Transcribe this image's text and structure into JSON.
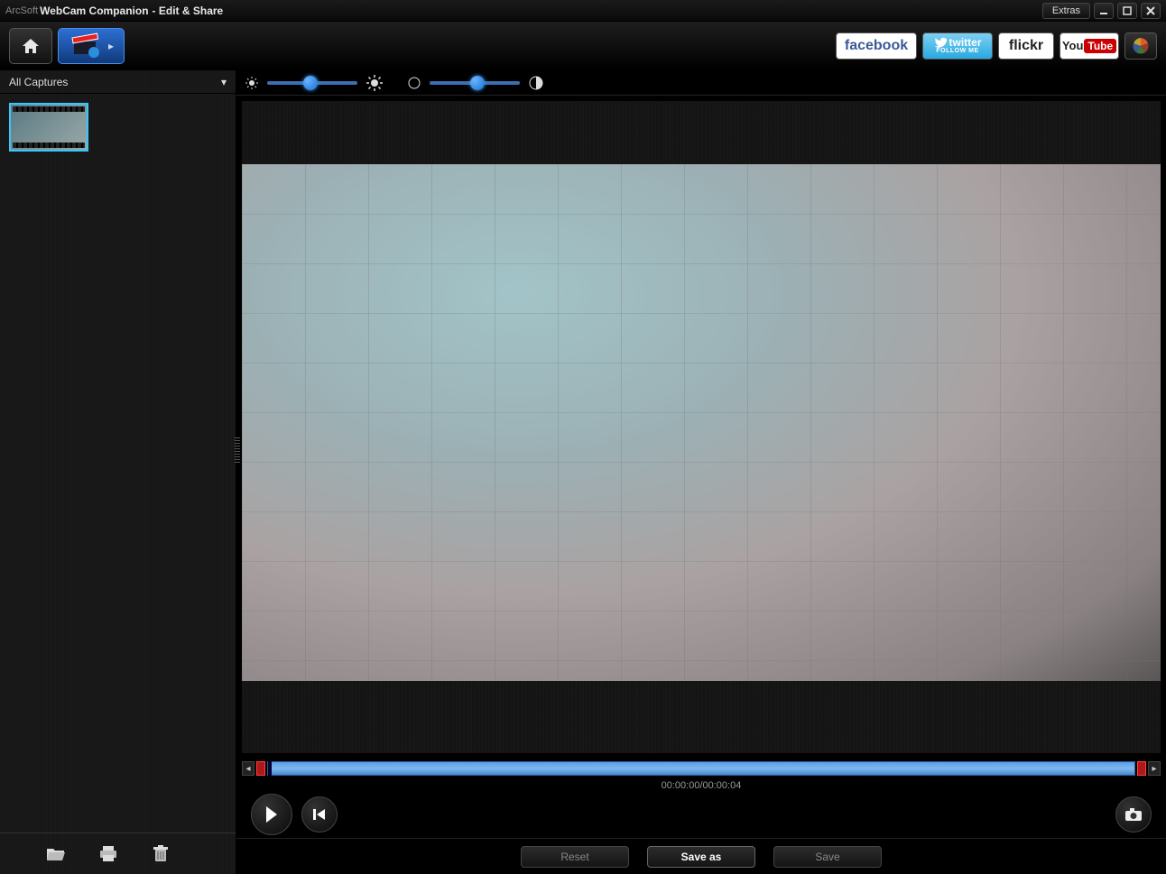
{
  "titlebar": {
    "brand": "ArcSoft",
    "app": "WebCam Companion",
    "subtitle": " - Edit & Share",
    "extras": "Extras"
  },
  "share": {
    "facebook": "facebook",
    "twitter_top": "twitter",
    "twitter_bottom": "FOLLOW ME",
    "flickr": "flickr",
    "youtube_you": "You",
    "youtube_tube": "Tube"
  },
  "sidebar": {
    "filter_label": "All Captures"
  },
  "sliders": {
    "brightness_pos_pct": 40,
    "contrast_pos_pct": 45
  },
  "timeline": {
    "timecode": "00:00:00/00:00:04"
  },
  "actions": {
    "reset": "Reset",
    "save_as": "Save as",
    "save": "Save"
  }
}
